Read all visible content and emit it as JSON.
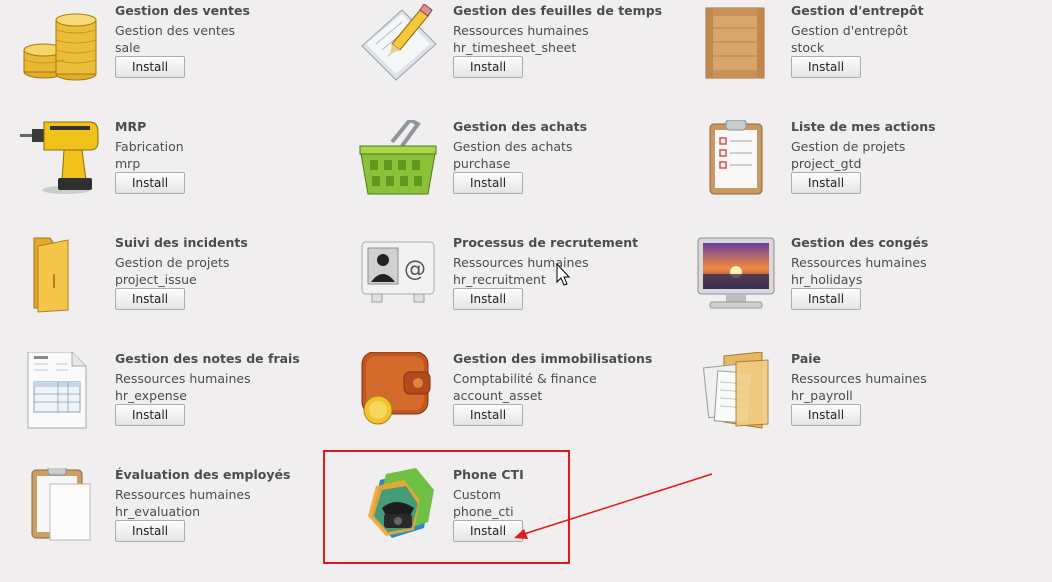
{
  "install_label": "Install",
  "modules": [
    {
      "title": "Gestion des ventes",
      "category": "Gestion des ventes",
      "technical": "sale",
      "icon": "coins-stack-icon"
    },
    {
      "title": "Gestion des feuilles de temps",
      "category": "Ressources humaines",
      "technical": "hr_timesheet_sheet",
      "icon": "timesheet-pencil-icon"
    },
    {
      "title": "Gestion d'entrepôt",
      "category": "Gestion d'entrepôt",
      "technical": "stock",
      "icon": "wooden-crate-icon"
    },
    {
      "title": "MRP",
      "category": "Fabrication",
      "technical": "mrp",
      "icon": "power-drill-icon"
    },
    {
      "title": "Gestion des achats",
      "category": "Gestion des achats",
      "technical": "purchase",
      "icon": "shopping-basket-icon"
    },
    {
      "title": "Liste de mes actions",
      "category": "Gestion de projets",
      "technical": "project_gtd",
      "icon": "clipboard-list-icon"
    },
    {
      "title": "Suivi des incidents",
      "category": "Gestion de projets",
      "technical": "project_issue",
      "icon": "folder-icon"
    },
    {
      "title": "Processus de recrutement",
      "category": "Ressources humaines",
      "technical": "hr_recruitment",
      "icon": "contact-card-icon"
    },
    {
      "title": "Gestion des congés",
      "category": "Ressources humaines",
      "technical": "hr_holidays",
      "icon": "sunset-monitor-icon"
    },
    {
      "title": "Gestion des notes de frais",
      "category": "Ressources humaines",
      "technical": "hr_expense",
      "icon": "invoice-document-icon"
    },
    {
      "title": "Gestion des immobilisations",
      "category": "Comptabilité & finance",
      "technical": "account_asset",
      "icon": "wallet-coin-icon"
    },
    {
      "title": "Paie",
      "category": "Ressources humaines",
      "technical": "hr_payroll",
      "icon": "documents-folder-icon"
    },
    {
      "title": "Évaluation des employés",
      "category": "Ressources humaines",
      "technical": "hr_evaluation",
      "icon": "clipboard-blank-icon"
    },
    {
      "title": "Phone CTI",
      "category": "Custom",
      "technical": "phone_cti",
      "icon": "phone-hexagon-icon"
    }
  ],
  "colors": {
    "background": "#f0eeee",
    "highlight": "#e2181b",
    "text": "#4c4c4c"
  }
}
